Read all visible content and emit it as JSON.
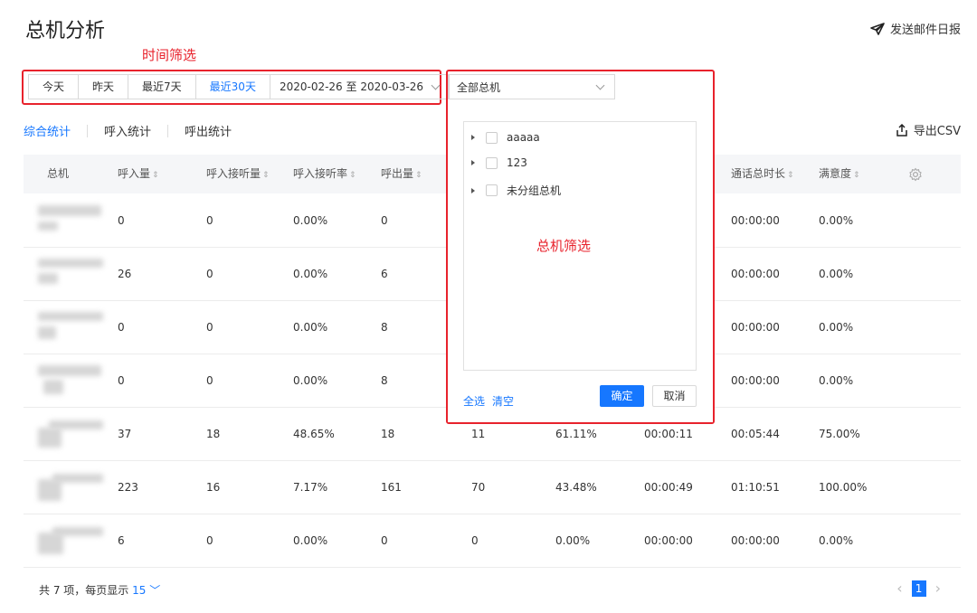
{
  "page": {
    "title": "总机分析"
  },
  "header": {
    "send_mail_label": "发送邮件日报"
  },
  "annotations": {
    "time_filter": "时间筛选",
    "host_filter": "总机筛选"
  },
  "time_filter": {
    "buttons": [
      "今天",
      "昨天",
      "最近7天",
      "最近30天"
    ],
    "active": "最近30天",
    "date_range": "2020-02-26 至 2020-03-26"
  },
  "host_select": {
    "value": "全部总机"
  },
  "tabs": [
    "综合统计",
    "呼入统计",
    "呼出统计"
  ],
  "active_tab": "综合统计",
  "export_label": "导出CSV",
  "table": {
    "columns": [
      "总机",
      "呼入量",
      "呼入接听量",
      "呼入接听率",
      "呼出量",
      "",
      "",
      "",
      "通话总时长",
      "满意度"
    ],
    "rows": [
      [
        "",
        "0",
        "0",
        "0.00%",
        "0",
        "",
        "",
        "",
        "00:00:00",
        "0.00%"
      ],
      [
        "",
        "26",
        "0",
        "0.00%",
        "6",
        "",
        "",
        "",
        "00:00:00",
        "0.00%"
      ],
      [
        "",
        "0",
        "0",
        "0.00%",
        "8",
        "",
        "",
        "",
        "00:00:00",
        "0.00%"
      ],
      [
        "",
        "0",
        "0",
        "0.00%",
        "8",
        "",
        "",
        "",
        "00:00:00",
        "0.00%"
      ],
      [
        "",
        "37",
        "18",
        "48.65%",
        "18",
        "11",
        "61.11%",
        "00:00:11",
        "00:05:44",
        "75.00%"
      ],
      [
        "",
        "223",
        "16",
        "7.17%",
        "161",
        "70",
        "43.48%",
        "00:00:49",
        "01:10:51",
        "100.00%"
      ],
      [
        "",
        "6",
        "0",
        "0.00%",
        "0",
        "0",
        "0.00%",
        "00:00:00",
        "00:00:00",
        "0.00%"
      ]
    ]
  },
  "footer": {
    "total_text": "共 7 项，每页显示",
    "page_size": "15",
    "current_page": "1"
  },
  "dropdown": {
    "tree_nodes": [
      "aaaaa",
      "123",
      "未分组总机"
    ],
    "select_all": "全选",
    "clear": "清空",
    "confirm": "确定",
    "cancel": "取消"
  },
  "colors": {
    "accent": "#1677ff",
    "annotation": "#e8222c"
  }
}
